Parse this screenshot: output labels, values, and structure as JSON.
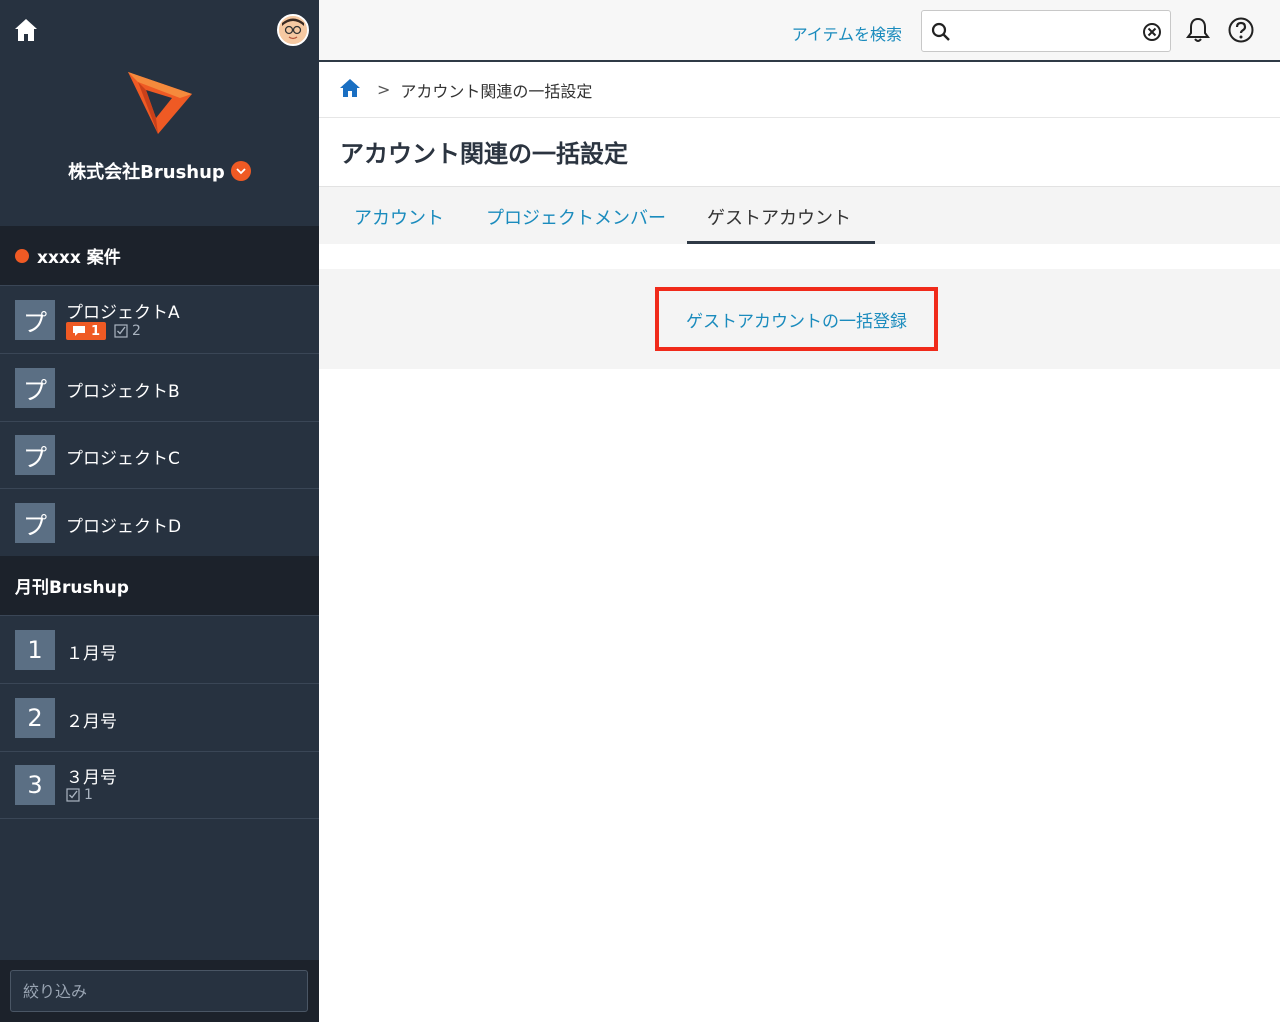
{
  "sidebar": {
    "company_name": "株式会社Brushup",
    "groups": [
      {
        "title": "xxxx 案件",
        "items": [
          {
            "icon_char": "プ",
            "label": "プロジェクトA",
            "comment_count": "1",
            "task_count": "2"
          },
          {
            "icon_char": "プ",
            "label": "プロジェクトB"
          },
          {
            "icon_char": "プ",
            "label": "プロジェクトC"
          },
          {
            "icon_char": "プ",
            "label": "プロジェクトD"
          }
        ]
      },
      {
        "title": "月刊Brushup",
        "items": [
          {
            "icon_char": "1",
            "label": "１月号"
          },
          {
            "icon_char": "2",
            "label": "２月号"
          },
          {
            "icon_char": "3",
            "label": "３月号",
            "task_count": "1"
          }
        ]
      }
    ],
    "filter_placeholder": "絞り込み"
  },
  "header": {
    "search_link": "アイテムを検索",
    "search_value": ""
  },
  "breadcrumb": {
    "separator": ">",
    "current": "アカウント関連の一括設定"
  },
  "page": {
    "title": "アカウント関連の一括設定",
    "tabs": [
      {
        "label": "アカウント"
      },
      {
        "label": "プロジェクトメンバー"
      },
      {
        "label": "ゲストアカウント"
      }
    ],
    "active_tab": "ゲストアカウント",
    "bulk_button_label": "ゲストアカウントの一括登録"
  },
  "colors": {
    "sidebar_bg": "#273240",
    "accent_orange": "#ef5a24",
    "link_blue": "#1a8bbd",
    "highlight_red": "#f02a1a"
  }
}
